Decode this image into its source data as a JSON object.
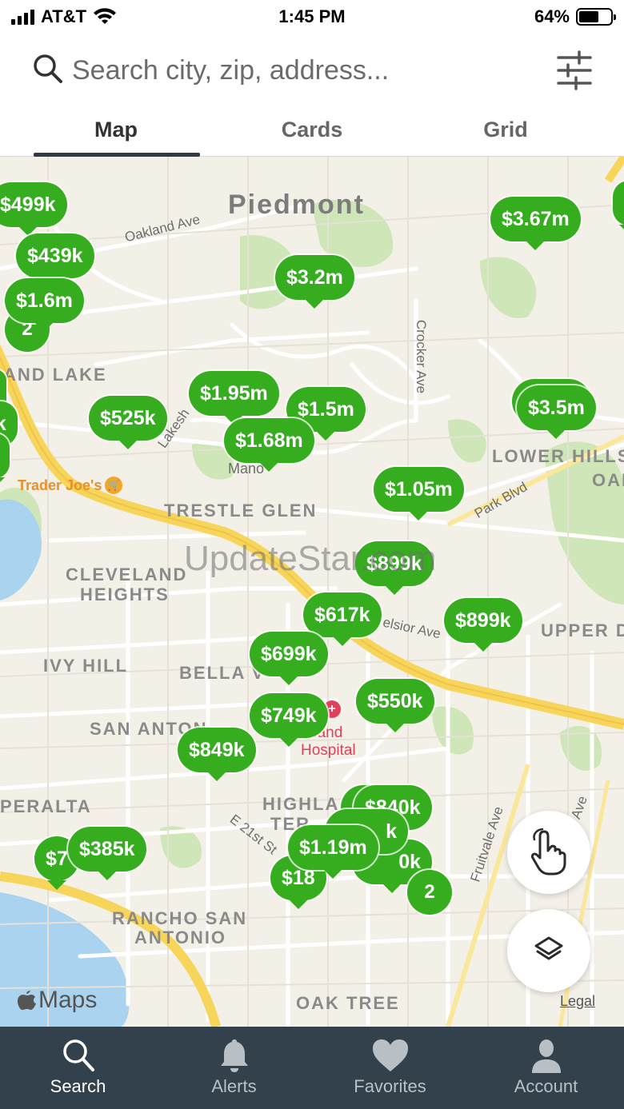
{
  "status": {
    "carrier": "AT&T",
    "time": "1:45 PM",
    "battery": "64%",
    "battery_level": 0.64
  },
  "search": {
    "placeholder": "Search city, zip, address..."
  },
  "tabs": [
    {
      "label": "Map",
      "active": true
    },
    {
      "label": "Cards",
      "active": false
    },
    {
      "label": "Grid",
      "active": false
    }
  ],
  "map": {
    "places": {
      "piedmont": "Piedmont",
      "grand_lake": "AND LAKE",
      "trestle_glen": "TRESTLE GLEN",
      "cleveland_1": "CLEVELAND",
      "cleveland_2": "HEIGHTS",
      "ivy_hill": "IVY HILL",
      "bella": "BELLA V",
      "san_antonio": "SAN ANTON",
      "peralta": "PERALTA",
      "highland_1": "HIGHLA",
      "highland_2": "TER",
      "rancho_1": "RANCHO SAN",
      "rancho_2": "ANTONIO",
      "oak_tree": "OAK TREE",
      "lower_hills": "LOWER HILLS",
      "oak": "OAK",
      "upper": "UPPER D",
      "manor": "Mano",
      "hospital_1": "land",
      "hospital_2": "Hospital"
    },
    "streets": {
      "oakland_ave": "Oakland Ave",
      "lakeshore": "Lakesh",
      "crocker": "Crocker Ave",
      "park_blvd": "Park Blvd",
      "excelsior": "elsior Ave",
      "e21st": "E 21st St",
      "fruitvale": "Fruitvale Ave",
      "ave_right": "Ave"
    },
    "poi": {
      "trader_joes": "Trader Joe's"
    },
    "watermark": "UpdateStar.com",
    "pins": [
      {
        "price": "$499k"
      },
      {
        "price": "$439k"
      },
      {
        "price": "$1.6m"
      },
      {
        "price": "$3.2m"
      },
      {
        "price": "$3.67m"
      },
      {
        "price": "$525k"
      },
      {
        "price": "$1.95m"
      },
      {
        "price": "$1.5m"
      },
      {
        "price": "$1.68m"
      },
      {
        "price": "$3.5m"
      },
      {
        "price": "$1.05m"
      },
      {
        "price": "$899k"
      },
      {
        "price": "$617k"
      },
      {
        "price": "$899k"
      },
      {
        "price": "$699k"
      },
      {
        "price": "$550k"
      },
      {
        "price": "$749k"
      },
      {
        "price": "$849k"
      },
      {
        "price": "$840k"
      },
      {
        "price": "$7"
      },
      {
        "price": "$385k"
      },
      {
        "price": "$1.19m"
      },
      {
        "price": "$18"
      },
      {
        "price": "k"
      },
      {
        "price": "0k"
      },
      {
        "price": "k"
      },
      {
        "price": "0k"
      },
      {
        "price": "m"
      }
    ],
    "clusters": [
      {
        "count": "2"
      },
      {
        "count": "2"
      }
    ],
    "attribution": {
      "maps": "Maps",
      "legal": "Legal"
    }
  },
  "bottom_nav": [
    {
      "label": "Search",
      "icon": "search-icon",
      "active": true
    },
    {
      "label": "Alerts",
      "icon": "bell-icon",
      "active": false
    },
    {
      "label": "Favorites",
      "icon": "heart-icon",
      "active": false
    },
    {
      "label": "Account",
      "icon": "person-icon",
      "active": false
    }
  ],
  "colors": {
    "pin": "#35ad1f",
    "nav": "#33414c",
    "road": "#f7d55a"
  }
}
